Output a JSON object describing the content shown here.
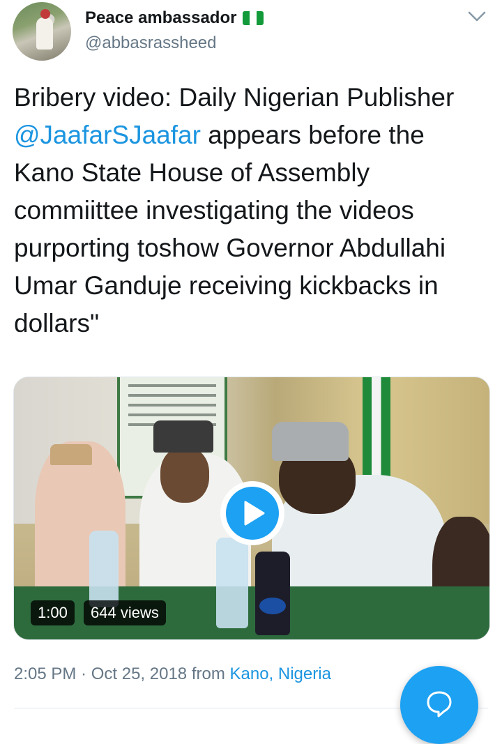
{
  "author": {
    "display_name": "Peace ambassador",
    "handle": "@abbasrassheed",
    "flag_icon": "nigeria-flag-icon"
  },
  "tweet": {
    "text_before": "Bribery video: Daily Nigerian Publisher ",
    "mention": "@JaafarSJaafar",
    "text_after": " appears before the Kano State House of Assembly commiittee investigating the videos purporting toshow Governor Abdullahi Umar Ganduje receiving kickbacks in dollars\""
  },
  "media": {
    "duration": "1:00",
    "views": "644 views",
    "play_icon": "play-icon"
  },
  "meta": {
    "time": "2:05 PM",
    "separator": " · ",
    "date": "Oct 25, 2018",
    "from_label": " from ",
    "location": "Kano, Nigeria"
  },
  "colors": {
    "accent": "#1da1f2",
    "link": "#1b95e0",
    "secondary_text": "#657786"
  }
}
